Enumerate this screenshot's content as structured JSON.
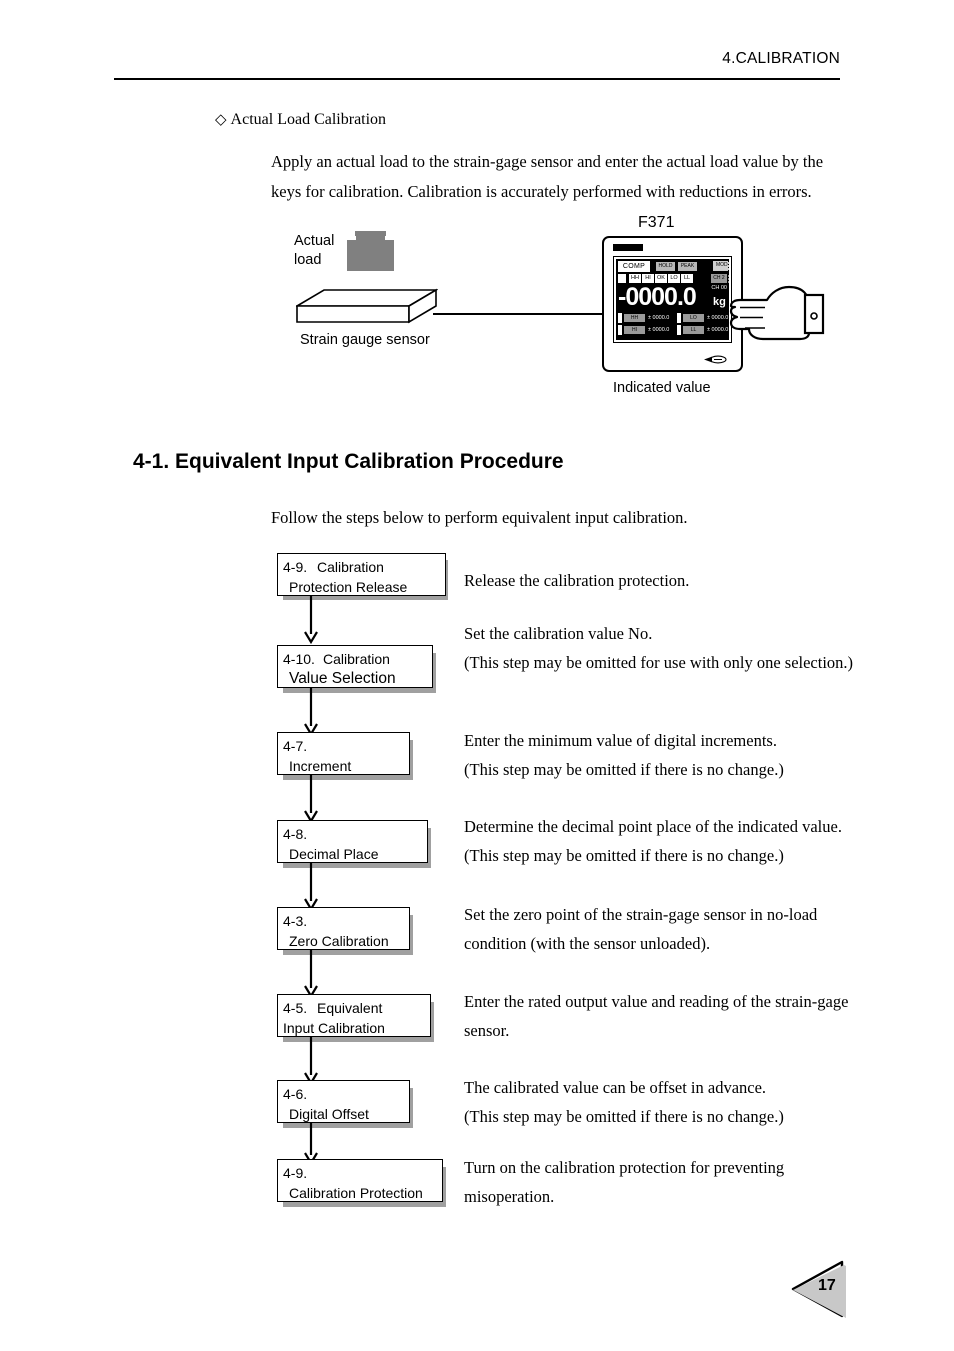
{
  "header": {
    "chapter_title": "4.CALIBRATION"
  },
  "intro": {
    "bullet_glyph": "◇",
    "bullet_title": "Actual Load Calibration",
    "paragraph": "Apply an actual load to the strain-gage sensor and enter the actual load value by the keys for calibration. Calibration is accurately performed with reductions in errors."
  },
  "figure": {
    "actual_load_label_line1": "Actual",
    "actual_load_label_line2": "load",
    "sensor_label": "Strain gauge sensor",
    "device_model": "F371",
    "indicated_value_label": "Indicated value",
    "display": {
      "comp": "COMP",
      "hold": "HOLD",
      "peak": "PEAK",
      "mode": "MODE",
      "channel_chip": "CH 2",
      "flags": [
        "HH",
        "HI",
        "OK",
        "LO",
        "LL"
      ],
      "value": "-0000.0",
      "unit": "kg",
      "channel": "CH 00",
      "setpoints": [
        {
          "name": "HH",
          "value": "± 0000.0"
        },
        {
          "name": "LO",
          "value": "± 0000.0"
        },
        {
          "name": "HI",
          "value": "± 0000.0"
        },
        {
          "name": "LL",
          "value": "± 0000.0"
        }
      ]
    }
  },
  "section": {
    "heading": "4-1. Equivalent Input Calibration Procedure",
    "follow_line": "Follow the steps below to perform equivalent input calibration."
  },
  "flowchart": {
    "steps": [
      {
        "ref": "4-9.",
        "title_line1": "Calibration",
        "title_line2": "Protection Release",
        "description": "Release the calibration protection."
      },
      {
        "ref": "4-10.",
        "title_line1": "Calibration",
        "title_line2": "Value Selection",
        "description": "Set the calibration value No.\n(This step may be omitted for use with only one selection.)"
      },
      {
        "ref": "4-7.",
        "title_line1": "",
        "title_line2": "Increment",
        "description": "Enter the minimum value of digital increments.\n(This step may be omitted if there is no change.)"
      },
      {
        "ref": "4-8.",
        "title_line1": "",
        "title_line2": "Decimal Place",
        "description": "Determine the decimal point place of the indicated value.\n(This step may be omitted if there is no change.)"
      },
      {
        "ref": "4-3.",
        "title_line1": "",
        "title_line2": "Zero Calibration",
        "description": "Set the zero point of the strain-gage sensor in no-load condition (with the sensor unloaded)."
      },
      {
        "ref": "4-5.",
        "title_line1": "Equivalent",
        "title_line2": "Input Calibration",
        "description": "Enter the rated output value and reading of the strain-gage sensor."
      },
      {
        "ref": "4-6.",
        "title_line1": "",
        "title_line2": "Digital Offset",
        "description": "The calibrated value can be offset in advance.\n(This step may be omitted if there is no change.)"
      },
      {
        "ref": "4-9.",
        "title_line1": "",
        "title_line2": "Calibration Protection",
        "description": "Turn on the calibration protection for preventing misoperation."
      }
    ]
  },
  "footer": {
    "page_number": "17"
  }
}
